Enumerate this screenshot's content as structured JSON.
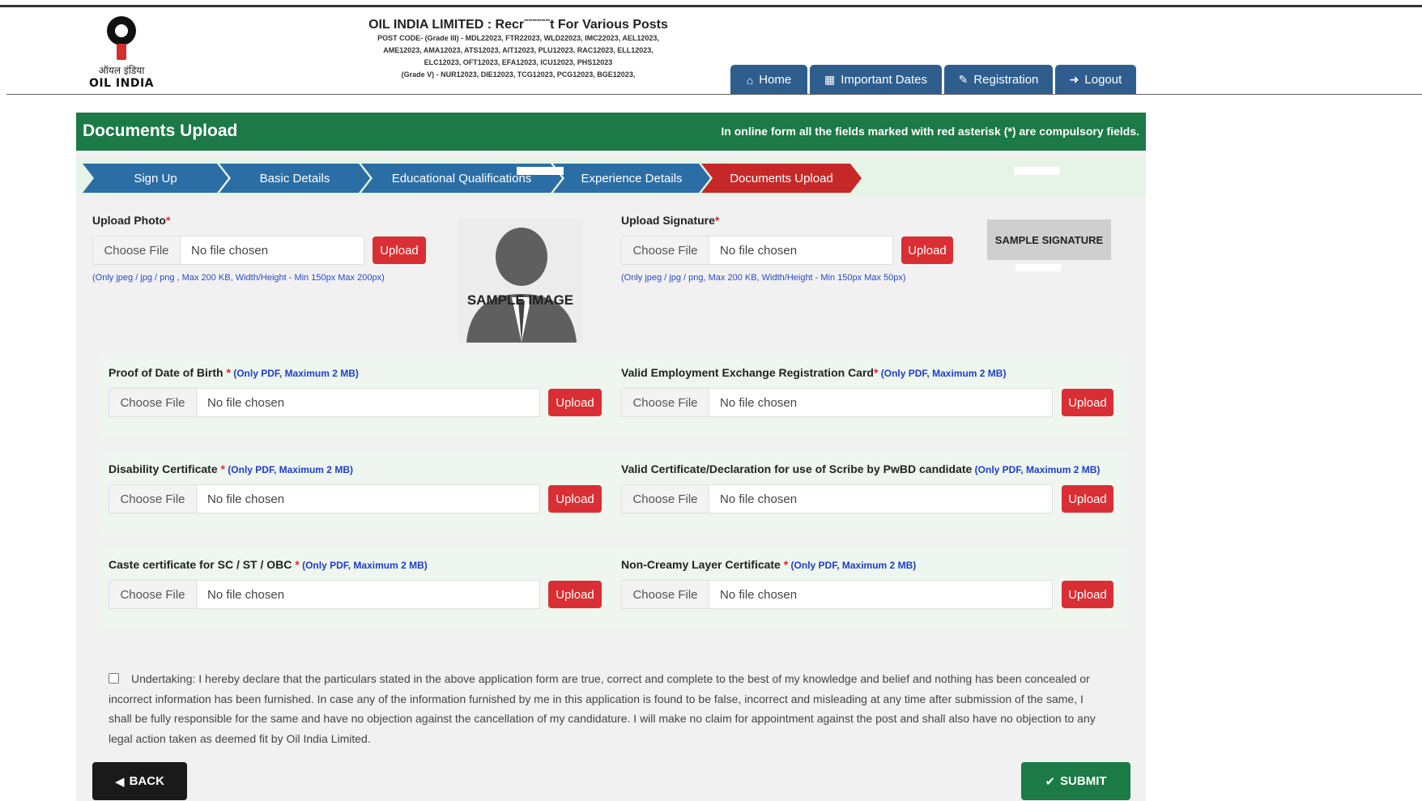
{
  "header": {
    "logo_hindi": "ऑयल इंडिया",
    "logo_english": "OIL INDIA",
    "title": "OIL INDIA LIMITED : Recrˉˉˉˉˉˉt For Various Posts",
    "post_lines": [
      "POST CODE- (Grade III) - MDL22023, FTR22023, WLD22023, IMC22023, AEL12023,",
      "AME12023, AMA12023, ATS12023, AIT12023, PLU12023, RAC12023, ELL12023,",
      "ELC12023, OFT12023, EFA12023, ICU12023, PHS12023",
      "(Grade V) - NUR12023, DIE12023, TCG12023, PCG12023, BGE12023,"
    ]
  },
  "nav": {
    "home": "Home",
    "important_dates": "Important Dates",
    "registration": "Registration",
    "logout": "Logout"
  },
  "page": {
    "title": "Documents Upload",
    "note": "In online form all the fields marked with red asterisk (*) are compulsory fields."
  },
  "steps": [
    "Sign Up",
    "Basic Details",
    "Educational Qualifications",
    "Experience Details",
    "Documents Upload"
  ],
  "common": {
    "choose_file": "Choose File",
    "no_file": "No file chosen",
    "upload": "Upload"
  },
  "photo": {
    "label": "Upload Photo",
    "req": "*",
    "note": "(Only jpeg / jpg / png , Max 200 KB, Width/Height - Min 150px Max 200px)",
    "sample": "SAMPLE IMAGE"
  },
  "signature": {
    "label": "Upload Signature",
    "req": "*",
    "note": "(Only jpeg / jpg / png, Max 200 KB, Width/Height - Min 150px Max 50px)",
    "sample": "SAMPLE SIGNATURE"
  },
  "docs": {
    "dob": {
      "label": "Proof of Date of Birth ",
      "req": "*",
      "hint": " (Only PDF, Maximum 2 MB)"
    },
    "employment": {
      "label": "Valid Employment Exchange Registration Card",
      "req": "*",
      "hint": " (Only PDF, Maximum 2 MB)"
    },
    "disability": {
      "label": "Disability Certificate ",
      "req": "*",
      "hint": " (Only PDF, Maximum 2 MB)"
    },
    "scribe": {
      "label": "Valid Certificate/Declaration for use of Scribe by PwBD candidate",
      "req": "",
      "hint": " (Only PDF, Maximum 2 MB)"
    },
    "caste": {
      "label": "Caste certificate for SC / ST / OBC ",
      "req": "*",
      "hint": " (Only PDF, Maximum 2 MB)"
    },
    "noncreamy": {
      "label": "Non-Creamy Layer Certificate ",
      "req": "*",
      "hint": " (Only PDF, Maximum 2 MB)"
    }
  },
  "undertaking": "Undertaking: I hereby declare that the particulars stated in the above application form are true, correct and complete to the best of my knowledge and belief and nothing has been concealed or incorrect information has been furnished. In case any of the information furnished by me in this application is found to be false, incorrect and misleading at any time after submission of the same, I shall be fully responsible for the same and have no objection against the cancellation of my candidature. I will make no claim for appointment against the post and shall also have no objection to any legal action taken as deemed fit by Oil India Limited.",
  "buttons": {
    "back": "BACK",
    "submit": "SUBMIT"
  },
  "icons": [
    "home-icon",
    "calendar-icon",
    "edit-icon",
    "sign-out-icon",
    "back-arrow-icon",
    "check-circle-icon"
  ]
}
